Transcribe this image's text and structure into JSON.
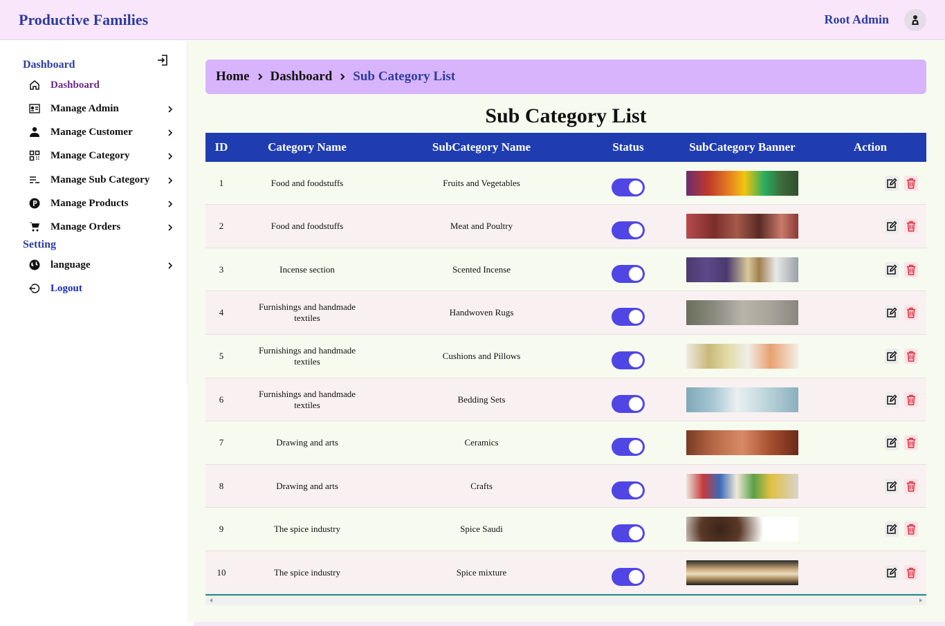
{
  "header": {
    "brand": "Productive Families",
    "user_name": "Root Admin",
    "avatar_icon": "user-avatar-icon"
  },
  "sidebar": {
    "section_dashboard": "Dashboard",
    "section_setting": "Setting",
    "items": [
      {
        "label": "Dashboard",
        "icon": "home-icon",
        "has_chevron": false
      },
      {
        "label": "Manage Admin",
        "icon": "id-card-icon",
        "has_chevron": true
      },
      {
        "label": "Manage Customer",
        "icon": "person-icon",
        "has_chevron": true
      },
      {
        "label": "Manage Category",
        "icon": "grid-icon",
        "has_chevron": true
      },
      {
        "label": "Manage Sub Category",
        "icon": "list-icon",
        "has_chevron": true
      },
      {
        "label": "Manage Products",
        "icon": "product-icon",
        "has_chevron": true
      },
      {
        "label": "Manage Orders",
        "icon": "cart-icon",
        "has_chevron": true
      }
    ],
    "settings": [
      {
        "label": "language",
        "icon": "globe-icon",
        "has_chevron": true
      },
      {
        "label": "Logout",
        "icon": "logout-icon",
        "has_chevron": false
      }
    ]
  },
  "breadcrumb": {
    "home": "Home",
    "dashboard": "Dashboard",
    "current": "Sub Category List"
  },
  "page_title": "Sub Category List",
  "table": {
    "columns": [
      "ID",
      "Category Name",
      "SubCategory Name",
      "Status",
      "SubCategory Banner",
      "Action"
    ],
    "rows": [
      {
        "id": "1",
        "category": "Food and foodstuffs",
        "subcategory": "Fruits and Vegetables",
        "status": true
      },
      {
        "id": "2",
        "category": "Food and foodstuffs",
        "subcategory": "Meat and Poultry",
        "status": true
      },
      {
        "id": "3",
        "category": "Incense section",
        "subcategory": "Scented Incense",
        "status": true
      },
      {
        "id": "4",
        "category": "Furnishings and handmade textiles",
        "subcategory": "Handwoven Rugs",
        "status": true
      },
      {
        "id": "5",
        "category": "Furnishings and handmade textiles",
        "subcategory": "Cushions and Pillows",
        "status": true
      },
      {
        "id": "6",
        "category": "Furnishings and handmade textiles",
        "subcategory": "Bedding Sets",
        "status": true
      },
      {
        "id": "7",
        "category": "Drawing and arts",
        "subcategory": "Ceramics",
        "status": true
      },
      {
        "id": "8",
        "category": "Drawing and arts",
        "subcategory": "Crafts",
        "status": true
      },
      {
        "id": "9",
        "category": "The spice industry",
        "subcategory": "Spice Saudi",
        "status": true
      },
      {
        "id": "10",
        "category": "The spice industry",
        "subcategory": "Spice mixture",
        "status": true
      }
    ]
  },
  "colors": {
    "brand_blue": "#2c3d9e",
    "table_header": "#1f3db0",
    "toggle_on": "#4f46e5",
    "breadcrumb_bg": "#d8b4fc",
    "delete_red": "#e0283a"
  }
}
